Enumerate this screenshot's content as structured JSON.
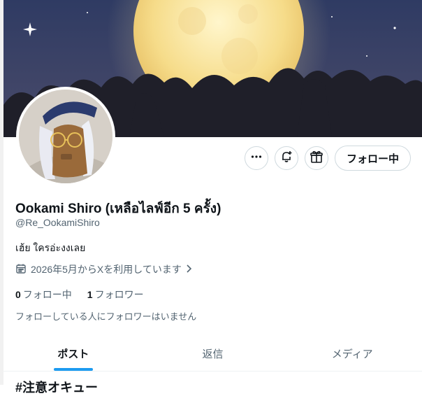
{
  "profile": {
    "display_name": "Ookami Shiro (เหลือไลฟ์อีก 5 ครั้ง)",
    "handle": "@Re_OokamiShiro",
    "bio": "เฮ้ย ใครอ่ะงงเลย",
    "joined": "2026年5月からXを利用しています",
    "following_count": "0",
    "following_label": "フォロー中",
    "followers_count": "1",
    "followers_label": "フォロワー",
    "followers_note": "フォローしている人にフォロワーはいません"
  },
  "actions": {
    "more_icon": "more-icon",
    "notify_icon": "bell-plus-icon",
    "gift_icon": "gift-icon",
    "follow_label": "フォロー中"
  },
  "tabs": [
    {
      "label": "ポスト",
      "active": true
    },
    {
      "label": "返信",
      "active": false
    },
    {
      "label": "メディア",
      "active": false
    }
  ],
  "next_heading": "#注意オキュー",
  "colors": {
    "accent": "#1d9bf0",
    "muted_text": "#536471",
    "border": "#cfd9de"
  }
}
